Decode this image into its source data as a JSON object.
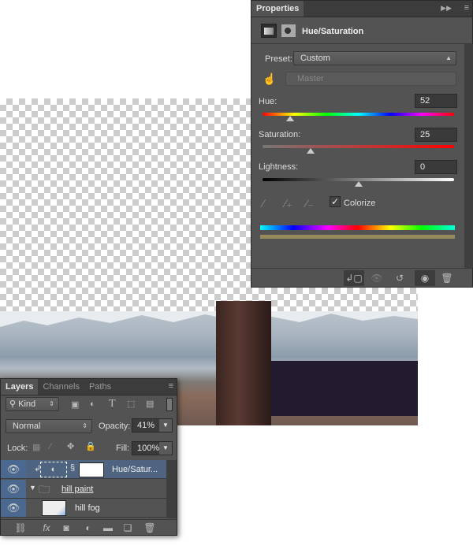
{
  "properties": {
    "tab": "Properties",
    "title": "Hue/Saturation",
    "preset_label": "Preset:",
    "preset_value": "Custom",
    "channel_value": "Master",
    "hue_label": "Hue:",
    "hue_value": "52",
    "saturation_label": "Saturation:",
    "saturation_value": "25",
    "lightness_label": "Lightness:",
    "lightness_value": "0",
    "colorize_label": "Colorize",
    "colorize_checked": true,
    "tint_color": "#978b5b"
  },
  "layers": {
    "tabs": [
      "Layers",
      "Channels",
      "Paths"
    ],
    "filter_kind": "Kind",
    "blend_mode": "Normal",
    "opacity_label": "Opacity:",
    "opacity_value": "41%",
    "lock_label": "Lock:",
    "fill_label": "Fill:",
    "fill_value": "100%",
    "items": [
      {
        "name": "Hue/Satur...",
        "selected": true
      },
      {
        "name": "hill paint",
        "type": "group"
      },
      {
        "name": "hill fog"
      }
    ]
  },
  "colors": {
    "panel": "#535353",
    "selection": "#4a6890"
  }
}
